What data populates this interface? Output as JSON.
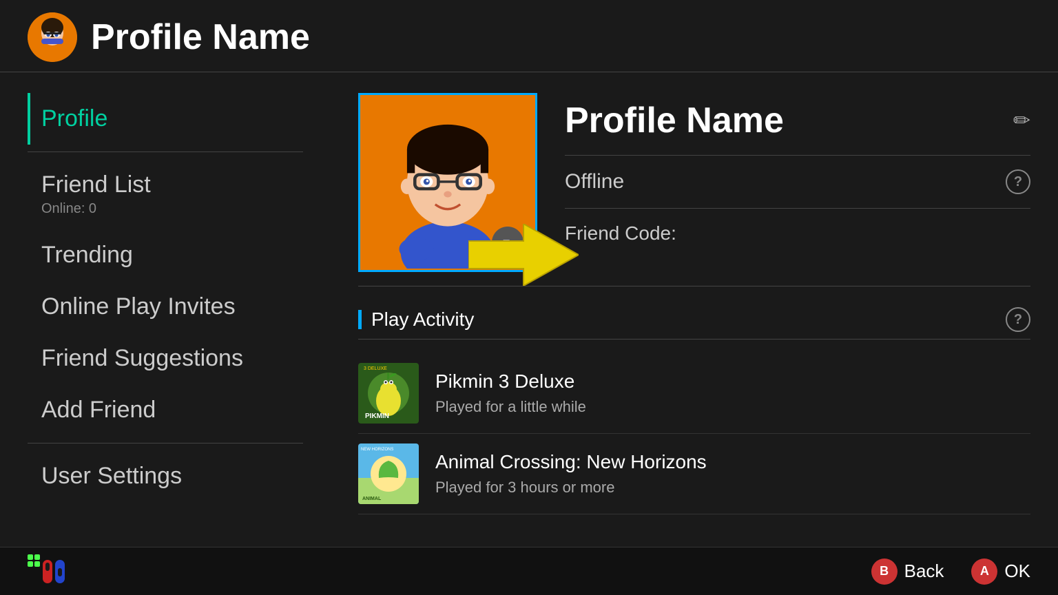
{
  "header": {
    "title": "Profile Name"
  },
  "sidebar": {
    "items": [
      {
        "id": "profile",
        "label": "Profile",
        "active": true
      },
      {
        "id": "friend-list",
        "label": "Friend List",
        "sub": "Online: 0"
      },
      {
        "id": "trending",
        "label": "Trending"
      },
      {
        "id": "online-play-invites",
        "label": "Online Play Invites"
      },
      {
        "id": "friend-suggestions",
        "label": "Friend Suggestions"
      },
      {
        "id": "add-friend",
        "label": "Add Friend"
      },
      {
        "id": "user-settings",
        "label": "User Settings"
      }
    ]
  },
  "profile": {
    "name": "Profile Name",
    "status": "Offline",
    "friend_code_label": "Friend Code:"
  },
  "play_activity": {
    "title": "Play Activity",
    "games": [
      {
        "id": "pikmin3",
        "name": "Pikmin 3 Deluxe",
        "played": "Played for a little while",
        "color1": "#3a7a2a",
        "color2": "#f5a020"
      },
      {
        "id": "animal-crossing",
        "name": "Animal Crossing: New Horizons",
        "played": "Played for 3 hours or more",
        "color1": "#5aa0d8",
        "color2": "#a8d870"
      }
    ]
  },
  "bottom_bar": {
    "back_label": "Back",
    "ok_label": "OK",
    "back_btn": "B",
    "ok_btn": "A"
  },
  "icons": {
    "pencil": "✏",
    "question": "?",
    "edit_overlay": "✏"
  }
}
